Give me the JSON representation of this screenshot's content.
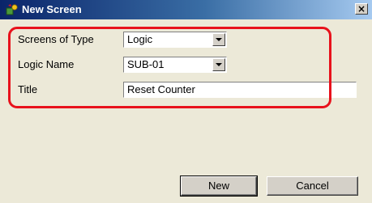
{
  "window": {
    "title": "New Screen",
    "close_label": "×"
  },
  "form": {
    "screen_type_label": "Screens of Type",
    "screen_type_value": "Logic",
    "logic_name_label": "Logic Name",
    "logic_name_value": "SUB-01",
    "title_label": "Title",
    "title_value": "Reset Counter"
  },
  "buttons": {
    "new_label": "New",
    "cancel_label": "Cancel"
  },
  "colors": {
    "highlight": "#e8121c",
    "titlebar": "#0a246a"
  }
}
